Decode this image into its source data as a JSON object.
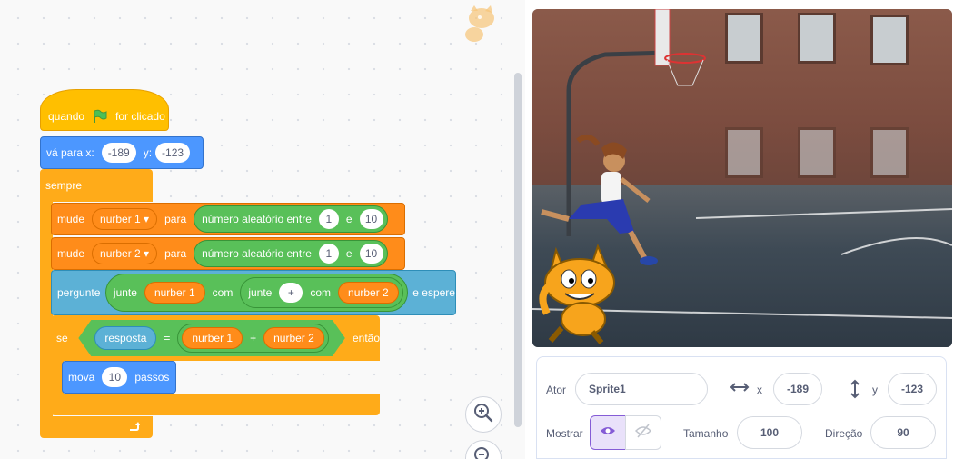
{
  "blocks": {
    "when_flag": {
      "prefix": "quando",
      "suffix": "for clicado"
    },
    "goto": {
      "label": "vá para x:",
      "x": "-189",
      "y_label": "y:",
      "y": "-123"
    },
    "forever": {
      "label": "sempre"
    },
    "set1": {
      "label": "mude",
      "var": "nurber 1 ▾",
      "to": "para",
      "random": "número aleatório entre",
      "from": "1",
      "and": "e",
      "to_val": "10"
    },
    "set2": {
      "label": "mude",
      "var": "nurber 2 ▾",
      "to": "para",
      "random": "número aleatório entre",
      "from": "1",
      "and": "e",
      "to_val": "10"
    },
    "ask": {
      "label": "pergunte",
      "join": "junte",
      "var1": "nurber 1",
      "with": "com",
      "join2": "junte",
      "plus": "+",
      "with2": "com",
      "var2": "nurber 2",
      "wait": "e espere"
    },
    "if": {
      "label": "se",
      "answer": "resposta",
      "eq": "=",
      "var1": "nurber 1",
      "plus": "+",
      "var2": "nurber 2",
      "then": "então"
    },
    "move": {
      "label": "mova",
      "steps": "10",
      "steps_label": "passos"
    }
  },
  "sprite_info": {
    "sprite_label": "Ator",
    "sprite_name": "Sprite1",
    "x_label": "x",
    "x_value": "-189",
    "y_label": "y",
    "y_value": "-123",
    "show_label": "Mostrar",
    "size_label": "Tamanho",
    "size_value": "100",
    "direction_label": "Direção",
    "direction_value": "90"
  },
  "colors": {
    "events": "#ffbf00",
    "control": "#ffab19",
    "motion": "#4c97ff",
    "variables": "#ff8c1a",
    "sensing": "#5cb1d6",
    "operators": "#59c059",
    "ui_accent": "#855cd6"
  },
  "icons": [
    "green-flag-icon",
    "repeat-arrow-icon",
    "zoom-in-icon",
    "zoom-out-icon",
    "horizontal-arrows-icon",
    "vertical-arrows-icon",
    "eye-icon",
    "eye-slash-icon",
    "cat-sprite-thumbnail"
  ]
}
